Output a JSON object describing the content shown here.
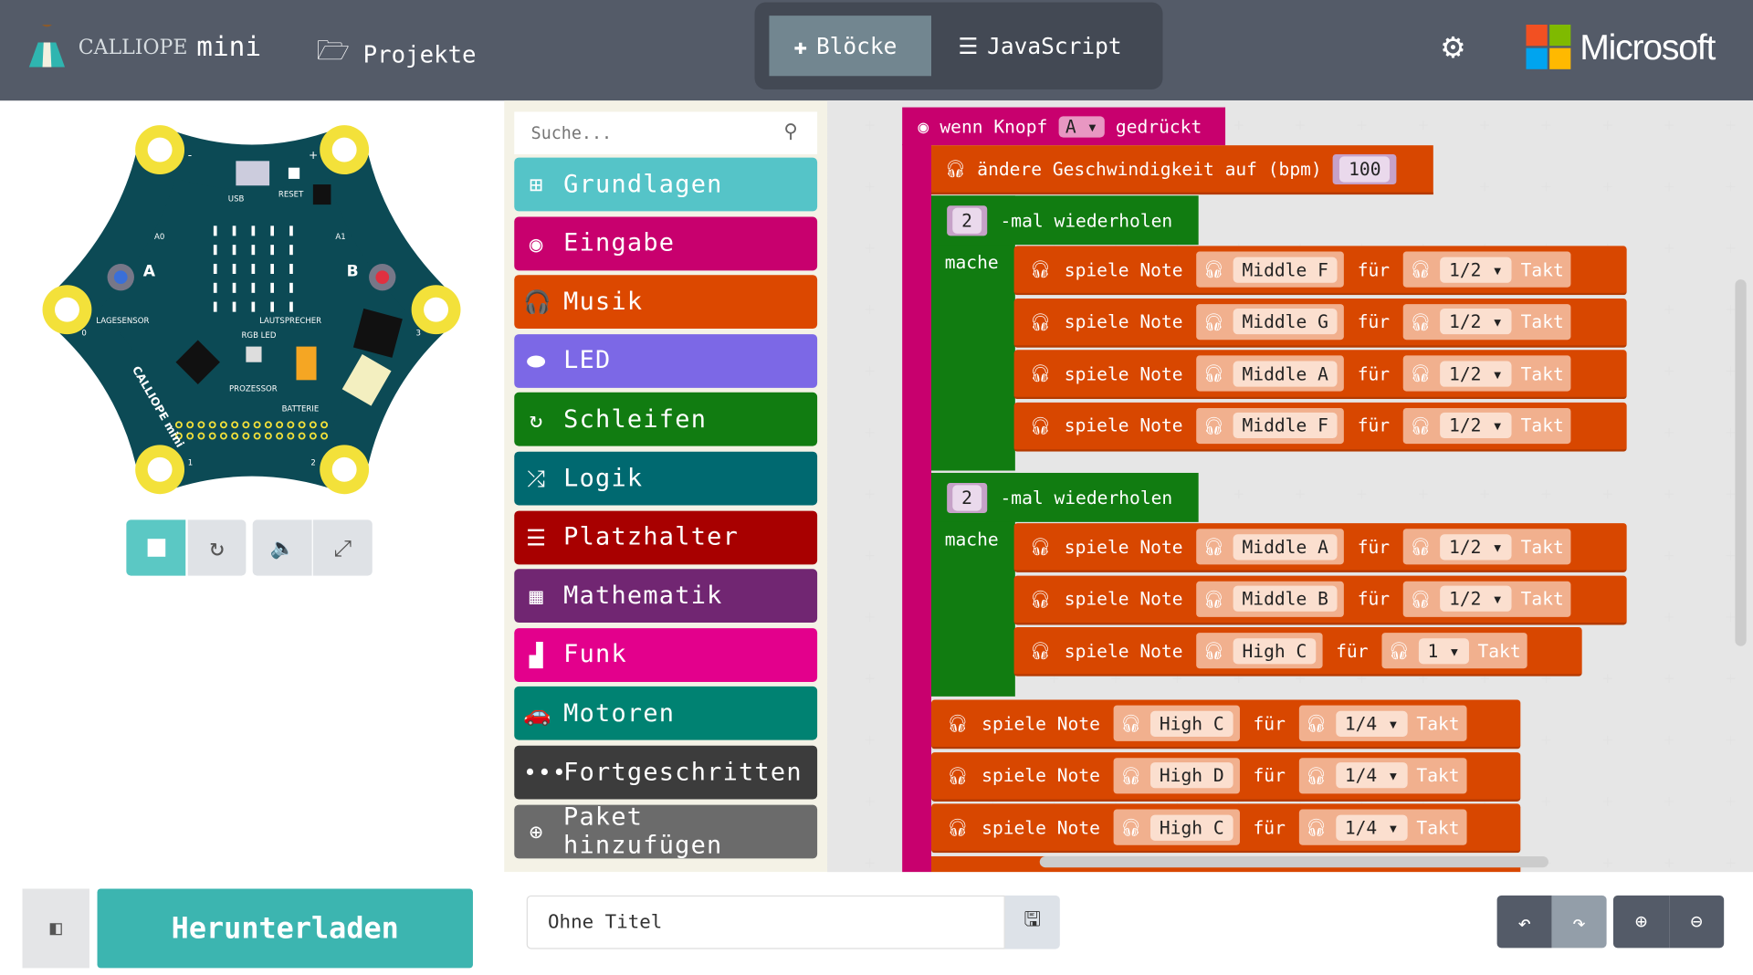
{
  "header": {
    "brand_a": "CALLIOPE",
    "brand_b": "mini",
    "projects": "Projekte",
    "tab_blocks": "Blöcke",
    "tab_js": "JavaScript",
    "microsoft": "Microsoft"
  },
  "board": {
    "usb": "USB",
    "reset": "RESET",
    "a0": "A0",
    "a1": "A1",
    "button_a": "A",
    "button_b": "B",
    "lagesensor": "LAGESENSOR",
    "lautsprecher": "LAUTSPRECHER",
    "rgb": "RGB LED",
    "prozessor": "PROZESSOR",
    "batterie": "BATTERIE",
    "brand": "CALLIOPE mini",
    "pin0": "0",
    "pin1": "1",
    "pin2": "2",
    "pin3": "3",
    "minus": "-",
    "plus": "+"
  },
  "simulator_controls": [
    "stop-icon",
    "restart-icon",
    "sound-icon",
    "fullscreen-icon"
  ],
  "toolbox": {
    "search_placeholder": "Suche...",
    "categories": [
      {
        "label": "Grundlagen",
        "color": "#55c4c8",
        "icon": "⊞"
      },
      {
        "label": "Eingabe",
        "color": "#c8006e",
        "icon": "◉"
      },
      {
        "label": "Musik",
        "color": "#dc4800",
        "icon": "🎧"
      },
      {
        "label": "LED",
        "color": "#7c68e6",
        "icon": "⬬"
      },
      {
        "label": "Schleifen",
        "color": "#117c11",
        "icon": "↻"
      },
      {
        "label": "Logik",
        "color": "#006970",
        "icon": "⤮"
      },
      {
        "label": "Platzhalter",
        "color": "#a80000",
        "icon": "☰"
      },
      {
        "label": "Mathematik",
        "color": "#712672",
        "icon": "▦"
      },
      {
        "label": "Funk",
        "color": "#e3008c",
        "icon": "▟"
      },
      {
        "label": "Motoren",
        "color": "#008272",
        "icon": "🚗"
      },
      {
        "label": "Fortgeschritten",
        "color": "#3c3c3c",
        "icon": "•••"
      },
      {
        "label": "Paket hinzufügen",
        "color": "#6b6b6b",
        "icon": "⊕"
      }
    ]
  },
  "blocks": {
    "hat": {
      "text_a": "wenn Knopf",
      "button": "A",
      "text_b": "gedrückt"
    },
    "tempo": {
      "text": "ändere Geschwindigkeit auf (bpm)",
      "value": "100"
    },
    "play": "spiele Note",
    "for": "für",
    "beat": "Takt",
    "mache": "mache",
    "repeats": [
      {
        "count": "2",
        "text": "-mal wiederholen",
        "notes": [
          [
            "Middle F",
            "1/2"
          ],
          [
            "Middle G",
            "1/2"
          ],
          [
            "Middle A",
            "1/2"
          ],
          [
            "Middle F",
            "1/2"
          ]
        ]
      },
      {
        "count": "2",
        "text": "-mal wiederholen",
        "notes": [
          [
            "Middle A",
            "1/2"
          ],
          [
            "Middle B",
            "1/2"
          ],
          [
            "High C",
            "1"
          ]
        ]
      }
    ],
    "after": [
      [
        "High C",
        "1/4"
      ],
      [
        "High D",
        "1/4"
      ],
      [
        "High C",
        "1/4"
      ]
    ]
  },
  "footer": {
    "download": "Herunterladen",
    "filename": "Ohne Titel"
  }
}
